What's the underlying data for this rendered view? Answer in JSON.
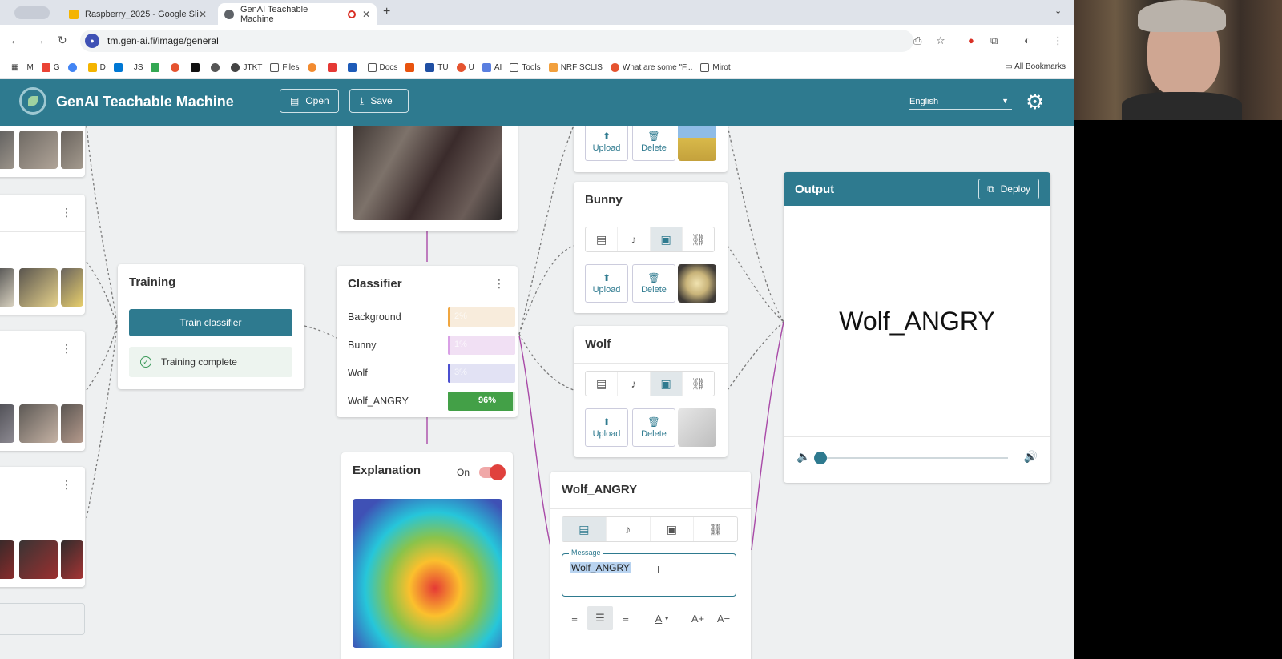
{
  "browser": {
    "tabs": [
      {
        "title": "Raspberry_2025 - Google Sli",
        "favicon_color": "#f4b400",
        "active": false
      },
      {
        "title": "GenAI Teachable Machine",
        "favicon_color": "#5f6368",
        "active": true
      }
    ],
    "url": "tm.gen-ai.fi/image/general",
    "bookmarks": [
      "M",
      "G",
      "O",
      "",
      "D",
      "",
      "JS",
      "",
      "",
      "",
      "",
      "JTKT",
      "Files",
      "",
      "",
      "",
      "Docs",
      "",
      "TU",
      "U",
      "AI",
      "Tools",
      "NRF SCLIS",
      "What are some \"F...",
      "Mirot"
    ],
    "all_bookmarks": "All Bookmarks"
  },
  "app": {
    "title": "GenAI Teachable Machine",
    "open_label": "Open",
    "save_label": "Save",
    "language": "English"
  },
  "training": {
    "title": "Training",
    "train_button": "Train classifier",
    "status": "Training complete"
  },
  "classifier": {
    "title": "Classifier",
    "classes": [
      {
        "label": "Background",
        "percent": 2,
        "color": "#f0a640",
        "bg": "#f8ecdc",
        "text": "2%"
      },
      {
        "label": "Bunny",
        "percent": 1,
        "color": "#d9a0e6",
        "bg": "#f1e0f4",
        "text": "1%"
      },
      {
        "label": "Wolf",
        "percent": 3,
        "color": "#4b4fd0",
        "bg": "#e2e2f4",
        "text": "3%"
      },
      {
        "label": "Wolf_ANGRY",
        "percent": 96,
        "color": "#43a047",
        "bg": "#dcefdc",
        "text": "96%"
      }
    ]
  },
  "explanation": {
    "title": "Explanation",
    "toggle_label": "On"
  },
  "outputs": {
    "top": {
      "upload": "Upload",
      "delete": "Delete"
    },
    "bunny": {
      "title": "Bunny",
      "upload": "Upload",
      "delete": "Delete"
    },
    "wolf": {
      "title": "Wolf",
      "upload": "Upload",
      "delete": "Delete"
    },
    "wolf_angry": {
      "title": "Wolf_ANGRY",
      "message_label": "Message",
      "message_value": "Wolf_ANGRY"
    }
  },
  "output_panel": {
    "title": "Output",
    "deploy_label": "Deploy",
    "display_text": "Wolf_ANGRY",
    "volume": 0.0
  }
}
